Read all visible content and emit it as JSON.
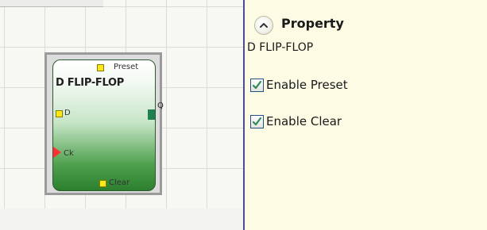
{
  "canvas": {
    "block": {
      "title": "D FLIP-FLOP",
      "pins": {
        "preset": "Preset",
        "d": "D",
        "q": "Q",
        "ck": "Ck",
        "clear": "Clear"
      }
    }
  },
  "panel": {
    "title": "Property",
    "subtitle": "D FLIP-FLOP",
    "options": [
      {
        "label": "Enable Preset",
        "checked": true
      },
      {
        "label": "Enable Clear",
        "checked": true
      }
    ]
  },
  "colors": {
    "panel_bg": "#fdfbe4",
    "divider": "#4d4d8e",
    "check": "#2e8b57",
    "pin_yellow": "#ffe81a",
    "pin_q": "#1f7f4f",
    "pin_ck": "#ff3030",
    "block_gradient_bottom": "#2c7f2c"
  },
  "icons": {
    "collapse": "chevron-up-icon",
    "check": "checkmark-icon"
  }
}
